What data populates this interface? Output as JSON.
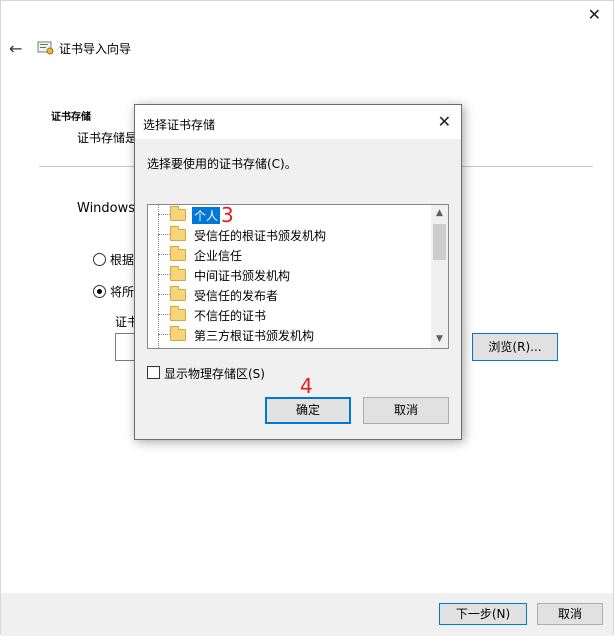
{
  "wizard": {
    "title": "证书导入向导",
    "section_title": "证书存储",
    "section_desc": "证书存储是",
    "windows_text": "Windows",
    "radio_auto_label": "根据",
    "radio_manual_label": "将所",
    "store_label": "证书",
    "browse_label": "浏览(R)...",
    "next_label": "下一步(N)",
    "cancel_label": "取消"
  },
  "dialog": {
    "title": "选择证书存储",
    "prompt": "选择要使用的证书存储(C)。",
    "stores": [
      {
        "label": "个人",
        "selected": true
      },
      {
        "label": "受信任的根证书颁发机构",
        "selected": false
      },
      {
        "label": "企业信任",
        "selected": false
      },
      {
        "label": "中间证书颁发机构",
        "selected": false
      },
      {
        "label": "受信任的发布者",
        "selected": false
      },
      {
        "label": "不信任的证书",
        "selected": false
      },
      {
        "label": "第三方根证书颁发机构",
        "selected": false
      }
    ],
    "show_physical_label": "显示物理存储区(S)",
    "ok_label": "确定",
    "cancel_label": "取消"
  },
  "annotations": {
    "step3": "3",
    "step4": "4"
  },
  "icons": {
    "back": "back-arrow-icon",
    "wizard": "certificate-icon",
    "close": "close-icon",
    "folder": "folder-icon"
  },
  "colors": {
    "selection": "#0078d7",
    "annotation": "#e02020"
  }
}
